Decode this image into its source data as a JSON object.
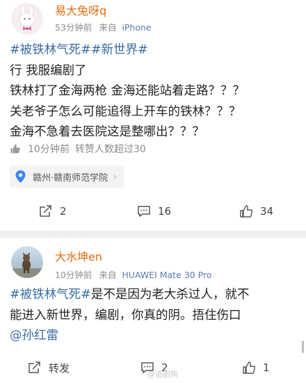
{
  "post1": {
    "author": "易大兔呀q",
    "time": "53分钟前",
    "source_prefix": "来自",
    "device": "iPhone",
    "content_lines": [
      [
        {
          "text": "#被铁林气死##新世界#",
          "type": "tag"
        }
      ],
      [
        {
          "text": "行 我服编剧了",
          "type": "text"
        }
      ],
      [
        {
          "text": "铁林打了金海两枪 金海还能站着走路？？？",
          "type": "text"
        }
      ],
      [
        {
          "text": "关老爷子怎么可能追得上开车的铁林？？？",
          "type": "text"
        }
      ],
      [
        {
          "text": "金海不急着去医院这是整哪出？？？",
          "type": "text"
        }
      ]
    ],
    "liked_time": "10分钟前",
    "liked_text": "转赞人数超过30",
    "location": "赣州·赣南师范学院",
    "repost_count": "2",
    "comment_count": "16",
    "like_count": "34",
    "accent": "#e86b0c"
  },
  "post2": {
    "author": "大水坤en",
    "time": "10分钟前",
    "source_prefix": "来自",
    "device": "HUAWEI Mate 30 Pro",
    "content_lines": [
      [
        {
          "text": "#被铁林气死#",
          "type": "tag"
        },
        {
          "text": "是不是因为老大杀过人，就不",
          "type": "text"
        }
      ],
      [
        {
          "text": "能进入新世界，编剧，你真的阴。捂住伤口",
          "type": "text"
        }
      ],
      [
        {
          "text": "@孙红雷",
          "type": "mention"
        }
      ]
    ],
    "repost_label": "转发",
    "comment_count": "2",
    "like_count": "1"
  },
  "watermark": "@追剧狗",
  "colors": {
    "link": "#3a6ea5",
    "meta": "#8c8c8c",
    "divider": "#efefef"
  }
}
